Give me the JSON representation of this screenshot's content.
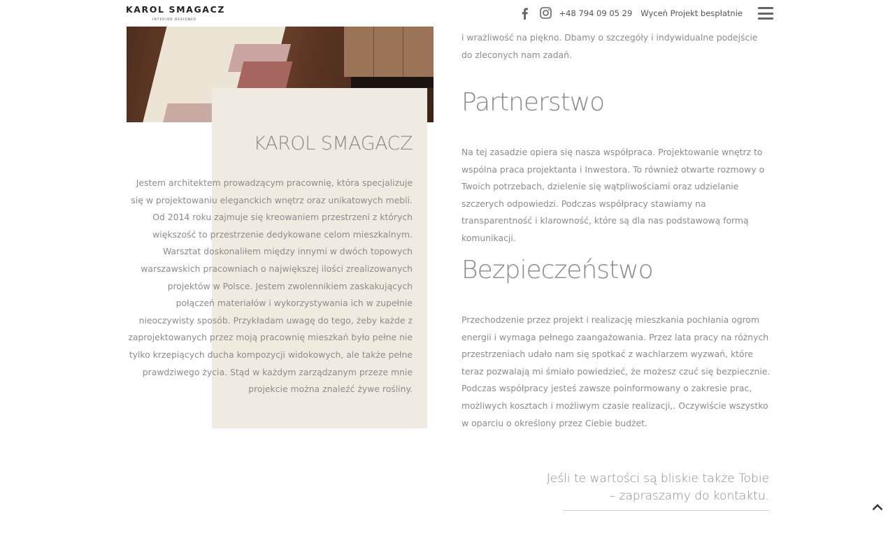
{
  "header": {
    "logo_name": "KAROL SMAGACZ",
    "logo_sub": "INTERIOR DESIGNER",
    "phone": "+48 794 09 05 29",
    "cta_label": "Wyceń Projekt bespłatnie",
    "icons": [
      "facebook-icon",
      "instagram-icon",
      "menu-icon"
    ]
  },
  "about": {
    "title": "KAROL SMAGACZ",
    "text": "Jestem architektem prowadzącym pracownię, która specjalizuje się w projektowaniu eleganckich wnętrz oraz unikatowych mebli. Od 2014 roku zajmuje się kreowaniem przestrzeni z których większość to przestrzenie dedykowane celom mieszkalnym. Warsztat doskonaliłem między innymi w dwóch topowych warszawskich pracowniach o największej ilości zrealizowanych projektów w Polsce. Jestem zwolennikiem zaskakujących połączeń materiałów i wykorzystywania ich w zupełnie nieoczywisty sposób. Przykładam uwagę do tego, żeby każde z zaprojektowanych przez moją pracownię mieszkań było pełne nie tylko krzepiących ducha kompozycji widokowych, ale także pełne prawdziwego życia. Stąd w każdym zarządzanym przeze mnie projekcie można znaleźć żywe rośliny."
  },
  "values": {
    "intro_text": "i wrażliwość na piękno. Dbamy o szczegóły i indywidualne podejście do zleconych nam zadań.",
    "partnerstwo_title": "Partnerstwo",
    "partnerstwo_text": "Na tej zasadzie opiera się nasza współpraca. Projektowanie wnętrz to wspólna praca projektanta i Inwestora. To również otwarte rozmowy o Twoich potrzebach, dzielenie się wątpliwościami oraz udzielanie szczerych odpowiedzi. Podczas współpracy stawiamy na transparentność i klarowność, które są dla nas podstawową formą komunikacji.",
    "bezpieczenstwo_title": "Bezpieczeństwo",
    "bezpieczenstwo_text": "Przechodzenie przez projekt i realizację mieszkania pochłania ogrom energii i wymaga pełnego zaangażowania. Przez lata pracy na różnych przestrzeniach udało nam się spotkać z wachlarzem wyzwań, które teraz pozwalają mi śmiało powiedzieć, że możesz czuć się bezpiecznie. Podczas współpracy jesteś zawsze poinformowany o zakresie prac, możliwych kosztach i możliwym czasie realizacji,. Oczywiście wszystko w oparciu o określony przez Ciebie budżet.",
    "closing_line1": "Jeśli te wartości są bliskie także Tobie",
    "closing_line2": "– zapraszamy do kontaktu."
  },
  "scroll_top_icon": "chevron-up-icon",
  "colors": {
    "beige_panel": "#efebe1",
    "text": "#8c8c8c",
    "heading": "#8a8a8a"
  }
}
